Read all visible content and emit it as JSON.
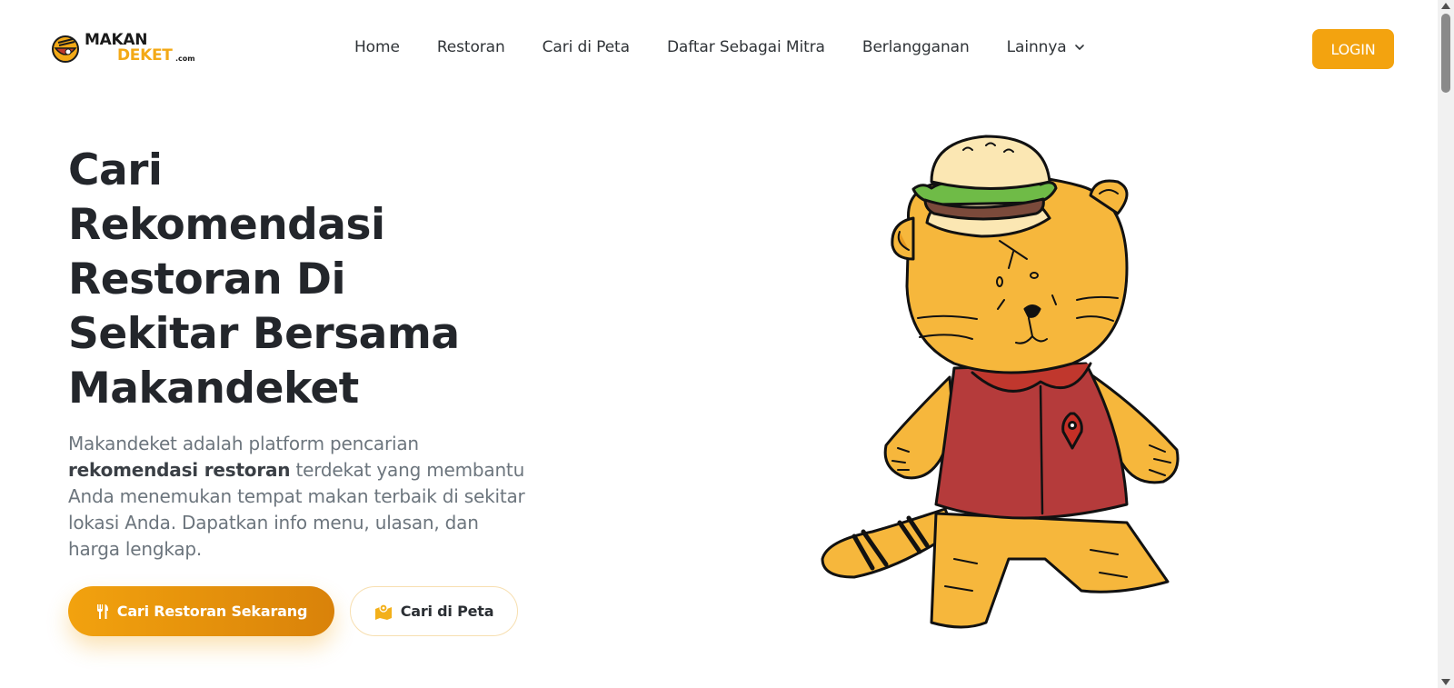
{
  "brand": {
    "name_top": "MAKAN",
    "name_bottom": "DEKET",
    "domain": ".com",
    "accent_color": "#f3a30f"
  },
  "nav": {
    "items": [
      {
        "label": "Home"
      },
      {
        "label": "Restoran"
      },
      {
        "label": "Cari di Peta"
      },
      {
        "label": "Daftar Sebagai Mitra"
      },
      {
        "label": "Berlangganan"
      },
      {
        "label": "Lainnya",
        "icon": "chevron-down-icon"
      }
    ],
    "login_label": "LOGIN"
  },
  "hero": {
    "title_lines": [
      "Cari",
      "Rekomendasi",
      "Restoran Di",
      "Sekitar Bersama",
      "Makandeket"
    ],
    "desc_part1": "Makandeket adalah platform pencarian ",
    "desc_bold": "rekomendasi restoran",
    "desc_part2": " terdekat yang membantu Anda menemukan tempat makan terbaik di sekitar lokasi Anda. Dapatkan info menu, ulasan, dan harga lengkap.",
    "primary_button": {
      "label": "Cari Restoran Sekarang",
      "icon": "utensils-icon"
    },
    "secondary_button": {
      "label": "Cari di Peta",
      "icon": "map-icon"
    },
    "illustration": "tiger-mascot-with-burger-hat"
  }
}
